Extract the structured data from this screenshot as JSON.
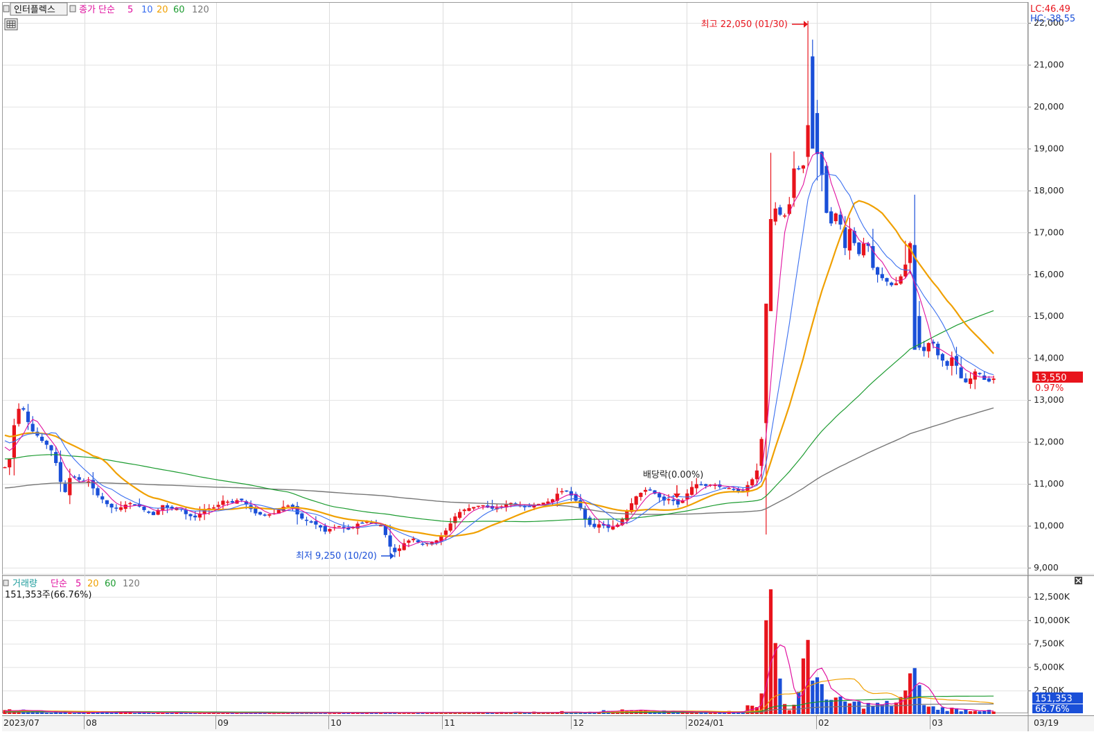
{
  "price_panel": {
    "stock_name": "인터플렉스",
    "legend": [
      {
        "text": "종가 단순",
        "color": "#e0109f"
      },
      {
        "text": "5",
        "color": "#e0109f"
      },
      {
        "text": "10",
        "color": "#3a6ff0"
      },
      {
        "text": "20",
        "color": "#f0a000"
      },
      {
        "text": "60",
        "color": "#1b9b2f"
      },
      {
        "text": "120",
        "color": "#777777"
      }
    ],
    "lc_text": "LC:46.49",
    "hc_text": "HC:-38.55",
    "high_annotation": "최고 22,050 (01/30)",
    "low_annotation": "최저 9,250 (10/20)",
    "dividend_annotation": "배당락(0.00%)",
    "current_price_tag": "13,550",
    "current_change_tag": "0.97%",
    "y_tick_labels": [
      "22,000",
      "21,000",
      "20,000",
      "19,000",
      "18,000",
      "17,000",
      "16,000",
      "15,000",
      "14,000",
      "13,000",
      "12,000",
      "11,000",
      "10,000",
      "9,000"
    ]
  },
  "volume_panel": {
    "legend": [
      {
        "text": "거래량",
        "color": "#1b9b9b"
      },
      {
        "text": "단순",
        "color": "#e0109f"
      },
      {
        "text": "5",
        "color": "#e0109f"
      },
      {
        "text": "20",
        "color": "#f0a000"
      },
      {
        "text": "60",
        "color": "#1b9b2f"
      },
      {
        "text": "120",
        "color": "#777777"
      }
    ],
    "current_volume_text": "151,353주(66.76%)",
    "current_volume_tag": "151,353",
    "current_ratio_tag": "66.76%",
    "y_tick_labels": [
      "12,500K",
      "10,000K",
      "7,500K",
      "5,000K",
      "2,500K"
    ]
  },
  "x_axis_labels": [
    "2023/07",
    "08",
    "09",
    "10",
    "11",
    "12",
    "2024/01",
    "02",
    "03",
    "03/19"
  ],
  "colors": {
    "up": "#e8141c",
    "down": "#1a4fd8",
    "ma5": "#e0109f",
    "ma10": "#3a6ff0",
    "ma20": "#f0a000",
    "ma60": "#1b9b2f",
    "ma120": "#777777"
  },
  "chart_data": [
    {
      "type": "candlestick",
      "title": "인터플렉스",
      "x_range": [
        "2023/07",
        "03/19"
      ],
      "ylim": [
        8900,
        22400
      ],
      "y_ticks": [
        9000,
        10000,
        11000,
        12000,
        13000,
        14000,
        15000,
        16000,
        17000,
        18000,
        19000,
        20000,
        21000,
        22000
      ],
      "x_labels": [
        "2023/07",
        "08",
        "09",
        "10",
        "11",
        "12",
        "2024/01",
        "02",
        "03",
        "03/19"
      ],
      "ohlc_anchors": [
        {
          "date": "2023/07 start",
          "close": 11400
        },
        {
          "date": "2023/07 mid",
          "close": 12900
        },
        {
          "date": "2023/08 start",
          "close": 10600
        },
        {
          "date": "2023/08 mid",
          "close": 10400
        },
        {
          "date": "2023/09 start",
          "close": 10450
        },
        {
          "date": "2023/09 mid",
          "close": 10500
        },
        {
          "date": "2023/10 start",
          "close": 10050
        },
        {
          "date": "10/20",
          "close": 9350,
          "low": 9250
        },
        {
          "date": "2023/11 start",
          "close": 10100
        },
        {
          "date": "2023/11 mid",
          "close": 10500
        },
        {
          "date": "2023/12 start",
          "close": 10200
        },
        {
          "date": "2023/12 mid",
          "close": 10650
        },
        {
          "date": "2024/01 start",
          "close": 10900
        },
        {
          "date": "2024/01 mid",
          "close": 17300
        },
        {
          "date": "01/30",
          "close": 18900,
          "high": 22050
        },
        {
          "date": "2024/02 start",
          "close": 17800
        },
        {
          "date": "2024/02 mid",
          "close": 16000
        },
        {
          "date": "2024/03 start",
          "close": 14200
        },
        {
          "date": "03/19",
          "close": 13550
        }
      ],
      "series": [
        {
          "name": "5",
          "color": "#e0109f"
        },
        {
          "name": "10",
          "color": "#3a6ff0"
        },
        {
          "name": "20",
          "color": "#f0a000"
        },
        {
          "name": "60",
          "color": "#1b9b2f"
        },
        {
          "name": "120",
          "color": "#777777"
        }
      ],
      "annotations": [
        {
          "text": "최고 22,050 (01/30)",
          "value": 22050
        },
        {
          "text": "최저 9,250 (10/20)",
          "value": 9250
        },
        {
          "text": "배당락(0.00%)"
        }
      ],
      "last_close": 13550,
      "last_change_pct": 0.97
    },
    {
      "type": "bar",
      "title": "거래량",
      "ylim": [
        0,
        13750
      ],
      "y_ticks": [
        2500,
        5000,
        7500,
        10000,
        12500
      ],
      "y_unit": "K",
      "x_labels": [
        "2023/07",
        "08",
        "09",
        "10",
        "11",
        "12",
        "2024/01",
        "02",
        "03",
        "03/19"
      ],
      "volume_anchors_k": [
        {
          "date": "2023/07 start",
          "value": 400
        },
        {
          "date": "2023/12 start",
          "value": 600
        },
        {
          "date": "2024/01 mid",
          "value": 10000
        },
        {
          "date": "2024/01 mid+1",
          "value": 13300
        },
        {
          "date": "01/30",
          "value": 7900
        },
        {
          "date": "2024/02 end",
          "value": 4900
        },
        {
          "date": "03/19",
          "value": 151
        }
      ],
      "series": [
        {
          "name": "5",
          "color": "#e0109f"
        },
        {
          "name": "20",
          "color": "#f0a000"
        },
        {
          "name": "60",
          "color": "#1b9b2f"
        },
        {
          "name": "120",
          "color": "#777777"
        }
      ],
      "last_volume": 151353,
      "last_ratio_pct": 66.76
    }
  ]
}
